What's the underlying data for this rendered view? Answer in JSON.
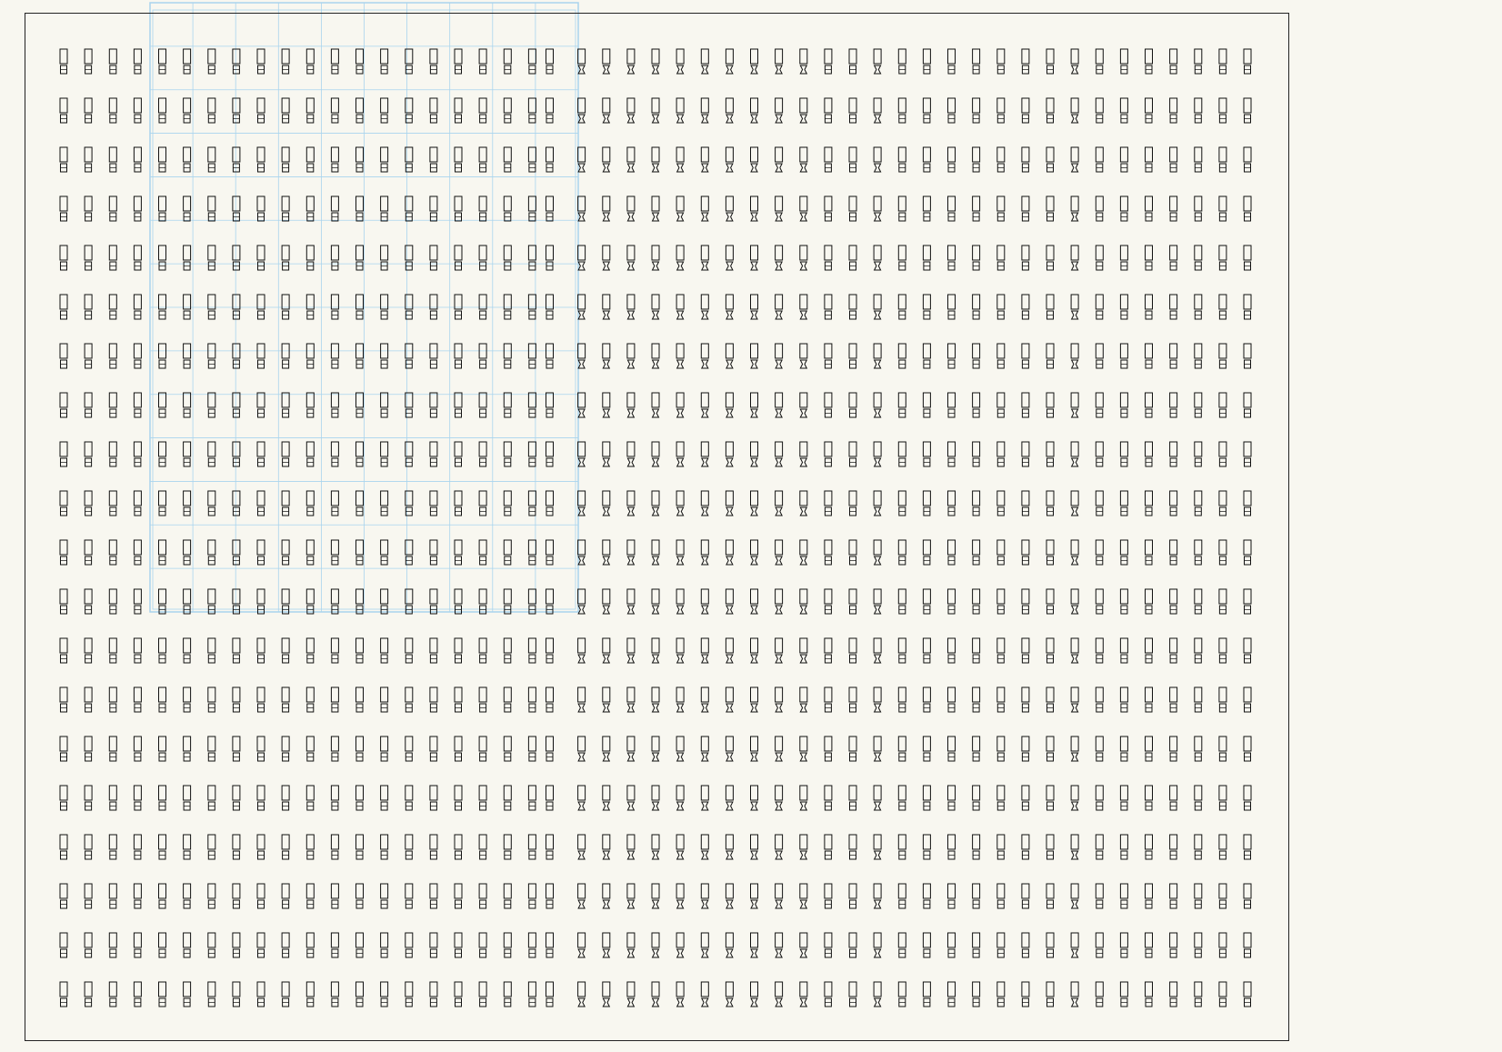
{
  "drawing": {
    "background_color": "#f8f7f0",
    "border_color": "#222222",
    "glyph_color": "#111111",
    "overlay_grid_color": "#a9d4ee"
  },
  "symbol_field": {
    "rows": 20,
    "columns": 49,
    "symbol_name": "tofu-placeholder-glyph-pair",
    "symbol_variants": [
      "plain-box-over-box",
      "box-over-hourglass-box"
    ]
  },
  "overlay_grid": {
    "columns": 10,
    "rows": 14
  }
}
